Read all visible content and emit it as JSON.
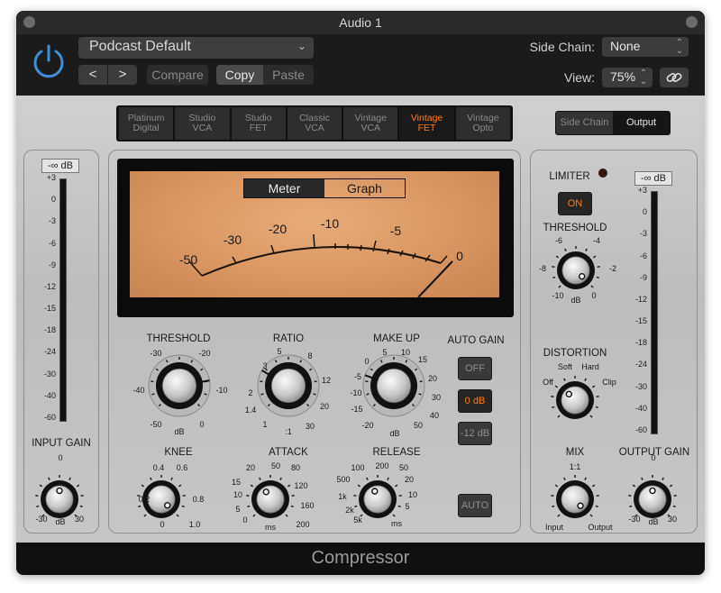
{
  "window": {
    "title": "Audio 1",
    "footer_title": "Compressor"
  },
  "header": {
    "preset": "Podcast Default",
    "compare_label": "Compare",
    "copy_label": "Copy",
    "paste_label": "Paste",
    "side_chain_label": "Side Chain:",
    "side_chain_value": "None",
    "view_label": "View:",
    "view_value": "75%",
    "nav_prev": "<",
    "nav_next": ">",
    "power_icon": "power-icon",
    "link_icon": "link-icon"
  },
  "circuit_types": [
    {
      "label": "Platinum Digital",
      "active": false
    },
    {
      "label": "Studio VCA",
      "active": false
    },
    {
      "label": "Studio FET",
      "active": false
    },
    {
      "label": "Classic VCA",
      "active": false
    },
    {
      "label": "Vintage VCA",
      "active": false
    },
    {
      "label": "Vintage FET",
      "active": true
    },
    {
      "label": "Vintage Opto",
      "active": false
    }
  ],
  "routing": {
    "side_chain": "Side Chain",
    "output": "Output",
    "active": "Output"
  },
  "meter_scale": [
    "+3",
    "0",
    "-3",
    "-6",
    "-9",
    "-12",
    "-15",
    "-18",
    "-24",
    "-30",
    "-40",
    "-60"
  ],
  "input": {
    "level": "-∞ dB",
    "label": "INPUT GAIN",
    "scale_min": "-30",
    "scale_mid": "0",
    "scale_unit": "dB",
    "scale_max": "30"
  },
  "output": {
    "level": "-∞ dB",
    "label": "OUTPUT GAIN",
    "scale_min": "-30",
    "scale_mid": "0",
    "scale_unit": "dB",
    "scale_max": "30"
  },
  "vu": {
    "tab_meter": "Meter",
    "tab_graph": "Graph",
    "active_tab": "Meter",
    "labels": [
      "-50",
      "-30",
      "-20",
      "-10",
      "-5",
      "0"
    ]
  },
  "threshold": {
    "label": "THRESHOLD",
    "scale": [
      "-30",
      "-20",
      "-40",
      "-10",
      "-50",
      "0",
      "dB"
    ]
  },
  "ratio": {
    "label": "RATIO",
    "scale": [
      "5",
      "8",
      "3",
      "12",
      "2",
      "20",
      "1.4",
      "30",
      "1",
      ":1"
    ]
  },
  "makeup": {
    "label": "MAKE UP",
    "scale": [
      "0",
      "5",
      "10",
      "15",
      "-5",
      "20",
      "-10",
      "30",
      "-15",
      "40",
      "-20",
      "50",
      "dB"
    ]
  },
  "auto_gain": {
    "label": "AUTO GAIN",
    "off": "OFF",
    "zero": "0 dB",
    "minus12": "-12 dB",
    "active": "0 dB"
  },
  "knee": {
    "label": "KNEE",
    "scale": [
      "0.4",
      "0.6",
      "0.2",
      "0.8",
      "0",
      "1.0"
    ]
  },
  "attack": {
    "label": "ATTACK",
    "scale": [
      "20",
      "50",
      "80",
      "15",
      "120",
      "10",
      "160",
      "5",
      "200",
      "0",
      "ms"
    ]
  },
  "release": {
    "label": "RELEASE",
    "scale": [
      "100",
      "200",
      "50",
      "500",
      "20",
      "1k",
      "10",
      "2k",
      "5",
      "5k",
      "ms"
    ]
  },
  "auto_release": "AUTO",
  "limiter": {
    "label": "LIMITER",
    "button": "ON",
    "threshold_label": "THRESHOLD",
    "scale": [
      "-6",
      "-4",
      "-8",
      "-2",
      "-10",
      "0",
      "dB"
    ]
  },
  "distortion": {
    "label": "DISTORTION",
    "scale": [
      "Soft",
      "Hard",
      "Off",
      "Clip"
    ]
  },
  "mix": {
    "label": "MIX",
    "scale": [
      "1:1",
      "Input",
      "Output"
    ]
  },
  "colors": {
    "accent": "#ff7a1a",
    "power": "#3d8fd6",
    "vu_face": "#d79460"
  }
}
